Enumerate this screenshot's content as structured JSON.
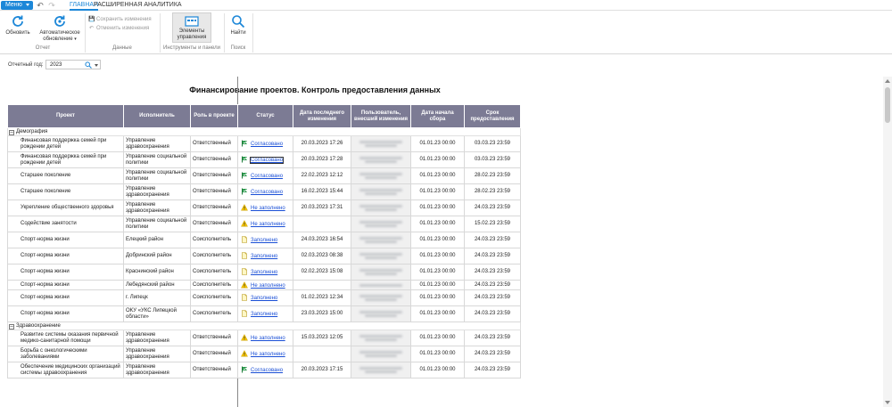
{
  "topbar": {
    "menu_label": "Меню",
    "tabs": [
      {
        "label": "ГЛАВНАЯ",
        "active": true
      },
      {
        "label": "РАСШИРЕННАЯ АНАЛИТИКА",
        "active": false
      }
    ],
    "icons": [
      "undo-icon",
      "redo-icon"
    ]
  },
  "ribbon": {
    "refresh_label": "Обновить",
    "auto_refresh_label_1": "Автоматическое",
    "auto_refresh_label_2": "обновление",
    "save_label": "Сохранить изменения",
    "cancel_label": "Отменить изменения",
    "elements_label_1": "Элементы",
    "elements_label_2": "управления",
    "find_label": "Найти",
    "groups": {
      "report": "Отчет",
      "data": "Данные",
      "tools": "Инструменты и панели",
      "search": "Поиск"
    },
    "accent_color": "#1c87d8"
  },
  "filter": {
    "year_label": "Отчетный год:",
    "year_value": "2023"
  },
  "report": {
    "title": "Финансирование проектов. Контроль предоставления данных",
    "header_color": "#7c7b94",
    "columns": [
      "Проект",
      "Исполнитель",
      "Роль в проекте",
      "Статус",
      "Дата последнего изменения",
      "Пользователь, внесший изменения",
      "Дата начала сбора",
      "Срок предоставления"
    ],
    "groups": [
      {
        "name": "Демография",
        "rows": [
          {
            "project": "Финансовая поддержка семей при рождении детей",
            "executor": "Управление здравоохранения",
            "role": "Ответственный",
            "status": "Согласовано",
            "status_type": "approved",
            "changed": "20.03.2023 17:26",
            "start": "01.01.23 00:00",
            "deadline": "03.03.23 23:59"
          },
          {
            "project": "Финансовая поддержка семей при рождении детей",
            "executor": "Управление социальной политики",
            "role": "Ответственный",
            "status": "Согласовано",
            "status_type": "approved",
            "boxed": true,
            "changed": "20.03.2023 17:28",
            "start": "01.01.23 00:00",
            "deadline": "03.03.23 23:59"
          },
          {
            "project": "Старшее поколение",
            "executor": "Управление социальной политики",
            "role": "Ответственный",
            "status": "Согласовано",
            "status_type": "approved",
            "changed": "22.02.2023 12:12",
            "start": "01.01.23 00:00",
            "deadline": "28.02.23 23:59"
          },
          {
            "project": "Старшее поколение",
            "executor": "Управление здравоохранения",
            "role": "Ответственный",
            "status": "Согласовано",
            "status_type": "approved",
            "changed": "16.02.2023 15:44",
            "start": "01.01.23 00:00",
            "deadline": "28.02.23 23:59"
          },
          {
            "project": "Укрепление общественного здоровья",
            "executor": "Управление здравоохранения",
            "role": "Ответственный",
            "status": "Не заполнено",
            "status_type": "warning",
            "changed": "20.03.2023 17:31",
            "start": "01.01.23 00:00",
            "deadline": "24.03.23 23:59"
          },
          {
            "project": "Содействие занятости",
            "executor": "Управление социальной политики",
            "role": "Ответственный",
            "status": "Не заполнено",
            "status_type": "warning",
            "changed": "",
            "start": "01.01.23 00:00",
            "deadline": "15.02.23 23:59"
          },
          {
            "project": "Спорт-норма жизни",
            "executor": "Елецкий район",
            "role": "Соисполнитель",
            "status": "Заполнено",
            "status_type": "filled",
            "changed": "24.03.2023 16:54",
            "start": "01.01.23 00:00",
            "deadline": "24.03.23 23:59"
          },
          {
            "project": "Спорт-норма жизни",
            "executor": "Добринский район",
            "role": "Соисполнитель",
            "status": "Заполнено",
            "status_type": "filled",
            "changed": "02.03.2023 08:38",
            "start": "01.01.23 00:00",
            "deadline": "24.03.23 23:59"
          },
          {
            "project": "Спорт-норма жизни",
            "executor": "Краснинский район",
            "role": "Соисполнитель",
            "status": "Заполнено",
            "status_type": "filled",
            "changed": "02.02.2023 15:08",
            "start": "01.01.23 00:00",
            "deadline": "24.03.23 23:59"
          },
          {
            "project": "Спорт-норма жизни",
            "executor": "Лебедянский район",
            "role": "Соисполнитель",
            "status": "Не заполнено",
            "status_type": "warning",
            "changed": "",
            "start": "01.01.23 00:00",
            "deadline": "24.03.23 23:59",
            "short": true
          },
          {
            "project": "Спорт-норма жизни",
            "executor": "г. Липецк",
            "role": "Соисполнитель",
            "status": "Заполнено",
            "status_type": "filled",
            "changed": "01.02.2023 12:34",
            "start": "01.01.23 00:00",
            "deadline": "24.03.23 23:59"
          },
          {
            "project": "Спорт-норма жизни",
            "executor": "ОКУ «УКС Липецкой области»",
            "role": "Соисполнитель",
            "status": "Заполнено",
            "status_type": "filled",
            "changed": "23.03.2023 15:00",
            "start": "01.01.23 00:00",
            "deadline": "24.03.23 23:59"
          }
        ]
      },
      {
        "name": "Здравоохранение",
        "rows": [
          {
            "project": "Развитие системы оказания первичной медико-санитарной помощи",
            "executor": "Управление здравоохранения",
            "role": "Ответственный",
            "status": "Не заполнено",
            "status_type": "warning",
            "changed": "15.03.2023 12:05",
            "start": "01.01.23 00:00",
            "deadline": "24.03.23 23:59"
          },
          {
            "project": "Борьба с онкологическими заболеваниями",
            "executor": "Управление здравоохранения",
            "role": "Ответственный",
            "status": "Не заполнено",
            "status_type": "warning",
            "changed": "",
            "start": "01.01.23 00:00",
            "deadline": "24.03.23 23:59"
          },
          {
            "project": "Обеспечение медицинских организаций системы здравоохранения",
            "executor": "Управление здравоохранения",
            "role": "Ответственный",
            "status": "Согласовано",
            "status_type": "approved",
            "changed": "20.03.2023 17:15",
            "start": "01.01.23 00:00",
            "deadline": "24.03.23 23:59"
          }
        ]
      }
    ]
  }
}
